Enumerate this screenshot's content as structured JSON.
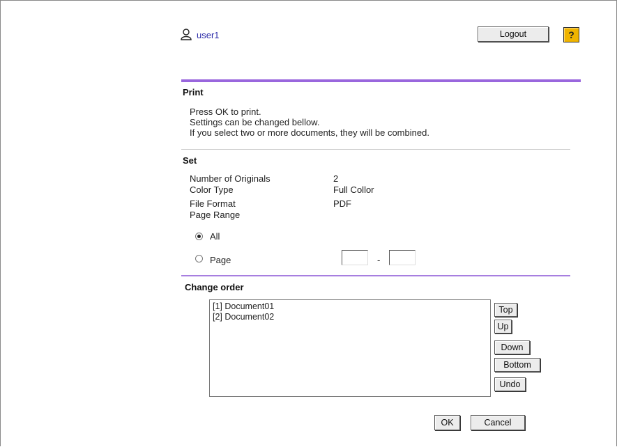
{
  "header": {
    "username": "user1",
    "logout_label": "Logout",
    "help_label": "?"
  },
  "print_section": {
    "title": "Print",
    "lines": [
      "Press OK to print.",
      "Settings can be changed bellow.",
      "If you select two or more documents, they will be combined."
    ]
  },
  "set_section": {
    "title": "Set",
    "rows": [
      {
        "label": "Number of Originals",
        "value": "2"
      },
      {
        "label": "Color Type",
        "value": "Full Collor"
      },
      {
        "label": "File Format",
        "value": "PDF"
      },
      {
        "label": "Page Range",
        "value": ""
      }
    ],
    "range_options": [
      {
        "label": "All",
        "selected": true
      },
      {
        "label": "Page",
        "selected": false
      }
    ],
    "page_from": "",
    "page_to": "",
    "range_separator": "-"
  },
  "order_section": {
    "title": "Change order",
    "documents": [
      "[1] Document01",
      "[2] Document02"
    ],
    "buttons": {
      "top": "Top",
      "up": "Up",
      "down": "Down",
      "bottom": "Bottom",
      "undo": "Undo"
    }
  },
  "footer": {
    "ok_label": "OK",
    "cancel_label": "Cancel"
  },
  "colors": {
    "accent_bar": "#9966dd",
    "link": "#2a2aa8",
    "help_icon": "#f0b400"
  },
  "icons": [
    "user-icon",
    "help-icon"
  ]
}
